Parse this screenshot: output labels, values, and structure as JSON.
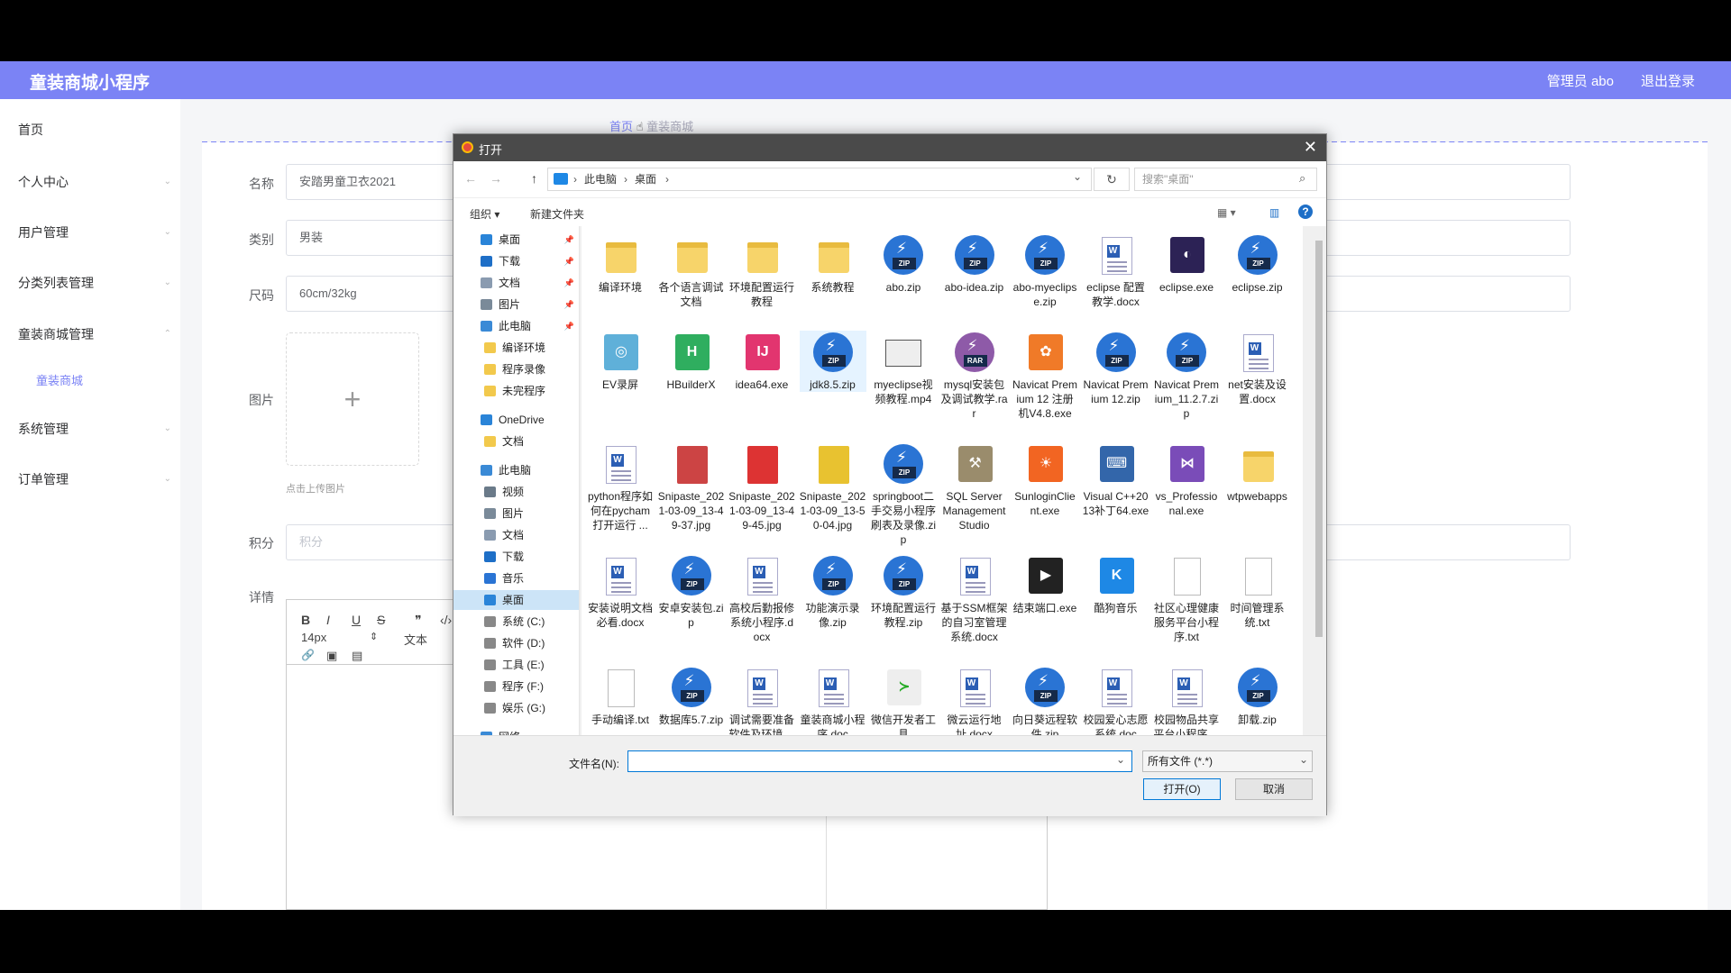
{
  "app": {
    "title": "童装商城小程序",
    "user": "管理员 abo",
    "logout": "退出登录"
  },
  "sidebar": {
    "items": [
      "首页",
      "个人中心",
      "用户管理",
      "分类列表管理",
      "童装商城管理",
      "系统管理",
      "订单管理"
    ],
    "sub": "童装商城"
  },
  "breadcrumb": {
    "home": "首页",
    "current": "童装商城"
  },
  "form": {
    "name_label": "名称",
    "name_value": "安踏男童卫衣2021",
    "cat_label": "类别",
    "cat_value": "男装",
    "size_label": "尺码",
    "size_value": "60cm/32kg",
    "img_label": "图片",
    "img_plus": "+",
    "img_hint": "点击上传图片",
    "points_label": "积分",
    "points_placeholder": "积分",
    "detail_label": "详情"
  },
  "editor": {
    "bold": "B",
    "italic": "I",
    "underline": "U",
    "strike": "S",
    "quote": "❞",
    "code": "‹/›",
    "size": "14px",
    "size_arrow": "⇕",
    "text": "文本",
    "link_icon": "🔗",
    "image_icon": "▣",
    "video_icon": "▤"
  },
  "dialog": {
    "title": "打开",
    "close": "✕",
    "back": "←",
    "forward": "→",
    "up": "↑",
    "path": [
      "此电脑",
      "桌面"
    ],
    "path_sep": "›",
    "addr_arrow": "⌄",
    "refresh": "↻",
    "search_placeholder": "搜索\"桌面\"",
    "search_icon": "⌕",
    "organize": "组织 ▾",
    "new_folder": "新建文件夹",
    "view_icon": "▦ ▾",
    "pane_icon": "▥",
    "help": "?",
    "tree": [
      {
        "label": "桌面",
        "icon": "folder-blue",
        "pin": true
      },
      {
        "label": "下载",
        "icon": "download",
        "pin": true
      },
      {
        "label": "文档",
        "icon": "document",
        "pin": true
      },
      {
        "label": "图片",
        "icon": "picture",
        "pin": true
      },
      {
        "label": "此电脑",
        "icon": "computer",
        "pin": true
      },
      {
        "label": "编译环境",
        "icon": "folder"
      },
      {
        "label": "程序录像",
        "icon": "folder"
      },
      {
        "label": "未完程序",
        "icon": "folder"
      },
      {
        "label": "OneDrive",
        "icon": "cloud",
        "gap": true
      },
      {
        "label": "文档",
        "icon": "folder"
      },
      {
        "label": "此电脑",
        "icon": "computer",
        "gap": true
      },
      {
        "label": "视频",
        "icon": "video"
      },
      {
        "label": "图片",
        "icon": "picture"
      },
      {
        "label": "文档",
        "icon": "document"
      },
      {
        "label": "下载",
        "icon": "download"
      },
      {
        "label": "音乐",
        "icon": "music"
      },
      {
        "label": "桌面",
        "icon": "folder-blue",
        "selected": true
      },
      {
        "label": "系统 (C:)",
        "icon": "drive"
      },
      {
        "label": "软件 (D:)",
        "icon": "drive"
      },
      {
        "label": "工具 (E:)",
        "icon": "drive"
      },
      {
        "label": "程序 (F:)",
        "icon": "drive"
      },
      {
        "label": "娱乐 (G:)",
        "icon": "drive"
      },
      {
        "label": "网络",
        "icon": "network",
        "gap": true
      }
    ],
    "files": [
      {
        "name": "编译环境",
        "type": "folder"
      },
      {
        "name": "各个语言调试文档",
        "type": "folder"
      },
      {
        "name": "环境配置运行教程",
        "type": "folder"
      },
      {
        "name": "系统教程",
        "type": "folder"
      },
      {
        "name": "abo.zip",
        "type": "zip"
      },
      {
        "name": "abo-idea.zip",
        "type": "zip"
      },
      {
        "name": "abo-myeclipse.zip",
        "type": "zip"
      },
      {
        "name": "eclipse 配置教学.docx",
        "type": "doc"
      },
      {
        "name": "eclipse.exe",
        "type": "app",
        "color": "#2c2255",
        "glyph": "◐"
      },
      {
        "name": "eclipse.zip",
        "type": "zip"
      },
      {
        "name": "EV录屏",
        "type": "app",
        "color": "#5fb0d9",
        "glyph": "◎"
      },
      {
        "name": "HBuilderX",
        "type": "app",
        "color": "#2fae5f",
        "glyph": "H"
      },
      {
        "name": "idea64.exe",
        "type": "app",
        "color": "#e2356f",
        "glyph": "IJ"
      },
      {
        "name": "jdk8.5.zip",
        "type": "zip",
        "hover": true
      },
      {
        "name": "myeclipse视频教程.mp4",
        "type": "video"
      },
      {
        "name": "mysql安装包及调试教学.rar",
        "type": "rar"
      },
      {
        "name": "Navicat Premium 12 注册机V4.8.exe",
        "type": "app",
        "color": "#f07a28",
        "glyph": "✿"
      },
      {
        "name": "Navicat Premium 12.zip",
        "type": "zip"
      },
      {
        "name": "Navicat Premium_11.2.7.zip",
        "type": "zip"
      },
      {
        "name": "net安装及设置.docx",
        "type": "doc"
      },
      {
        "name": "python程序如何在pycham打开运行 ...",
        "type": "doc"
      },
      {
        "name": "Snipaste_2021-03-09_13-49-37.jpg",
        "type": "img",
        "color": "#c44"
      },
      {
        "name": "Snipaste_2021-03-09_13-49-45.jpg",
        "type": "img",
        "color": "#d33"
      },
      {
        "name": "Snipaste_2021-03-09_13-50-04.jpg",
        "type": "img",
        "color": "#e8c230"
      },
      {
        "name": "springboot二手交易小程序刷表及录像.zip",
        "type": "zip"
      },
      {
        "name": "SQL Server Management Studio",
        "type": "app",
        "color": "#9a8c6c",
        "glyph": "⚒"
      },
      {
        "name": "SunloginClient.exe",
        "type": "app",
        "color": "#f26522",
        "glyph": "☀"
      },
      {
        "name": "Visual C++2013补丁64.exe",
        "type": "app",
        "color": "#3366aa",
        "glyph": "⌨"
      },
      {
        "name": "vs_Professional.exe",
        "type": "app",
        "color": "#7a4cb8",
        "glyph": "⋈"
      },
      {
        "name": "wtpwebapps",
        "type": "folder"
      },
      {
        "name": "安装说明文档必看.docx",
        "type": "doc"
      },
      {
        "name": "安卓安装包.zip",
        "type": "zip"
      },
      {
        "name": "高校后勤报修系统小程序.docx",
        "type": "doc"
      },
      {
        "name": "功能演示录像.zip",
        "type": "zip"
      },
      {
        "name": "环境配置运行教程.zip",
        "type": "zip"
      },
      {
        "name": "基于SSM框架的自习室管理系统.docx",
        "type": "doc"
      },
      {
        "name": "结束端口.exe",
        "type": "app",
        "color": "#222",
        "glyph": "▶"
      },
      {
        "name": "酷狗音乐",
        "type": "app",
        "color": "#1e88e5",
        "glyph": "K"
      },
      {
        "name": "社区心理健康服务平台小程序.txt",
        "type": "txt"
      },
      {
        "name": "时间管理系统.txt",
        "type": "txt"
      },
      {
        "name": "手动编译.txt",
        "type": "txt"
      },
      {
        "name": "数据库5.7.zip",
        "type": "zip"
      },
      {
        "name": "调试需要准备软件及环境 ...",
        "type": "doc"
      },
      {
        "name": "童装商城小程序.doc",
        "type": "doc"
      },
      {
        "name": "微信开发者工具",
        "type": "app",
        "color": "#eeeeee",
        "glyph": "≻"
      },
      {
        "name": "微云运行地址.docx",
        "type": "doc"
      },
      {
        "name": "向日葵远程软件.zip",
        "type": "zip"
      },
      {
        "name": "校园爱心志愿系统.doc",
        "type": "doc"
      },
      {
        "name": "校园物品共享平台小程序 ...",
        "type": "doc"
      },
      {
        "name": "卸载.zip",
        "type": "zip"
      }
    ],
    "filename_label": "文件名(N):",
    "filename_value": "",
    "filter": "所有文件 (*.*)",
    "open": "打开(O)",
    "cancel": "取消"
  }
}
